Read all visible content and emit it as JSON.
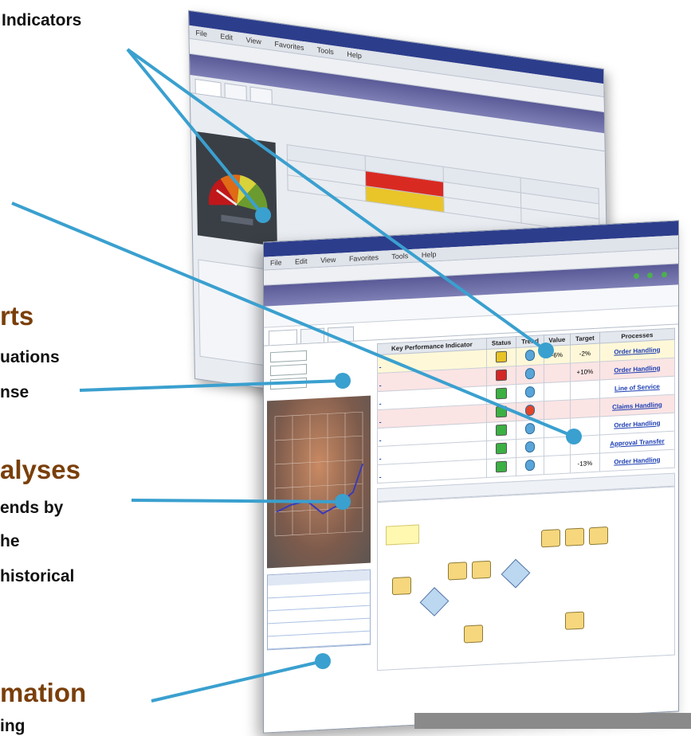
{
  "labels": {
    "top": "Indicators",
    "alerts_head": "rts",
    "alerts_l1": "uations",
    "alerts_l2": "nse",
    "analyses_head": "alyses",
    "analyses_l1": "ends by",
    "analyses_l2": "he",
    "analyses_l3": "historical",
    "info_head": "mation",
    "info_l1": "ing"
  },
  "colors": {
    "pointer_line": "#3aa0cf",
    "label_heading": "#7a3f0a",
    "window_titlebar": "#2c3d8c",
    "banner": "#6d6ea8"
  },
  "back_window": {
    "menu": [
      "File",
      "Edit",
      "View",
      "Favorites",
      "Tools",
      "Help"
    ]
  },
  "front_window": {
    "menu": [
      "File",
      "Edit",
      "View",
      "Favorites",
      "Tools",
      "Help"
    ]
  },
  "kpi_table": {
    "headers": [
      "Key Performance Indicator",
      "Status",
      "Trend",
      "Value",
      "Target",
      "Processes"
    ],
    "rows": [
      {
        "value": "-6%",
        "target": "-2%",
        "process": "Order Handling",
        "status": "yellow"
      },
      {
        "value": "",
        "target": "+10%",
        "process": "Order Handling",
        "status": "red"
      },
      {
        "value": "",
        "target": "",
        "process": "Line of Service",
        "status": "green"
      },
      {
        "value": "",
        "target": "",
        "process": "Claims Handling",
        "status": "green"
      },
      {
        "value": "",
        "target": "",
        "process": "Order Handling",
        "status": "green"
      },
      {
        "value": "",
        "target": "",
        "process": "Approval Transfer",
        "status": "green"
      },
      {
        "value": "",
        "target": "-13%",
        "process": "Order Handling",
        "status": "green"
      }
    ]
  },
  "icons": [
    "gauge-icon",
    "trend-arrow-icon",
    "status-light-icon",
    "pointer-line"
  ]
}
